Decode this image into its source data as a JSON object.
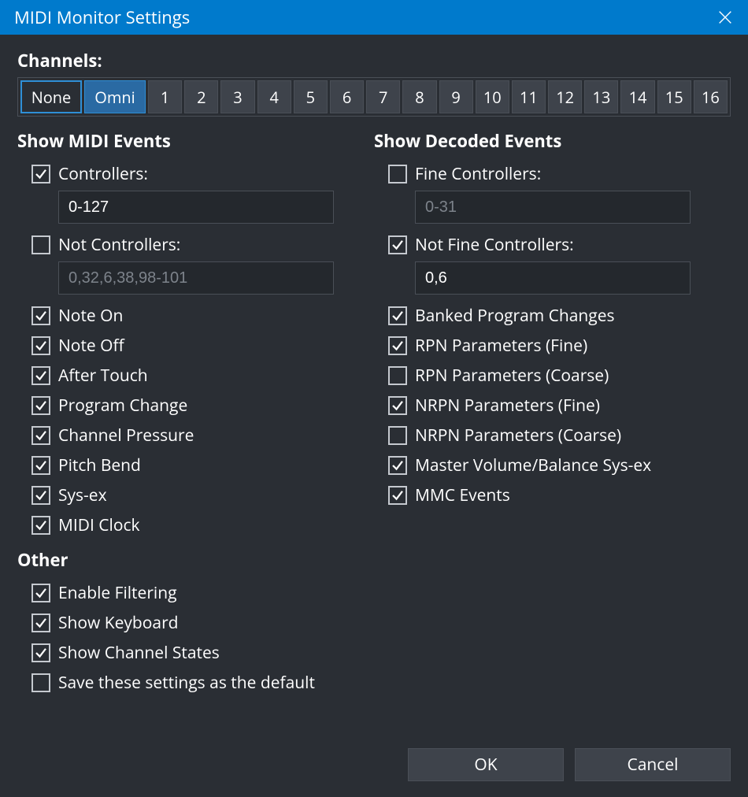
{
  "title": "MIDI Monitor Settings",
  "channels": {
    "label": "Channels:",
    "none": "None",
    "omni": "Omni",
    "nums": [
      "1",
      "2",
      "3",
      "4",
      "5",
      "6",
      "7",
      "8",
      "9",
      "10",
      "11",
      "12",
      "13",
      "14",
      "15",
      "16"
    ]
  },
  "midi_events": {
    "heading": "Show MIDI Events",
    "controllers_label": "Controllers:",
    "controllers_value": "0-127",
    "not_controllers_label": "Not Controllers:",
    "not_controllers_placeholder": "0,32,6,38,98-101",
    "note_on": "Note On",
    "note_off": "Note Off",
    "after_touch": "After Touch",
    "program_change": "Program Change",
    "channel_pressure": "Channel Pressure",
    "pitch_bend": "Pitch Bend",
    "sysex": "Sys-ex",
    "midi_clock": "MIDI Clock"
  },
  "decoded_events": {
    "heading": "Show Decoded Events",
    "fine_controllers_label": "Fine Controllers:",
    "fine_controllers_placeholder": "0-31",
    "not_fine_controllers_label": "Not Fine Controllers:",
    "not_fine_controllers_value": "0,6",
    "banked_pc": "Banked Program Changes",
    "rpn_fine": "RPN Parameters (Fine)",
    "rpn_coarse": "RPN Parameters (Coarse)",
    "nrpn_fine": "NRPN Parameters (Fine)",
    "nrpn_coarse": "NRPN Parameters (Coarse)",
    "mvb_sysex": "Master Volume/Balance Sys-ex",
    "mmc": "MMC Events"
  },
  "other": {
    "heading": "Other",
    "enable_filtering": "Enable Filtering",
    "show_keyboard": "Show Keyboard",
    "show_channel_states": "Show Channel States",
    "save_default": "Save these settings as the default"
  },
  "buttons": {
    "ok": "OK",
    "cancel": "Cancel"
  },
  "state": {
    "controllers_checked": true,
    "not_controllers_checked": false,
    "note_on": true,
    "note_off": true,
    "after_touch": true,
    "program_change": true,
    "channel_pressure": true,
    "pitch_bend": true,
    "sysex": true,
    "midi_clock": true,
    "fine_controllers_checked": false,
    "not_fine_controllers_checked": true,
    "banked_pc": true,
    "rpn_fine": true,
    "rpn_coarse": false,
    "nrpn_fine": true,
    "nrpn_coarse": false,
    "mvb_sysex": true,
    "mmc": true,
    "enable_filtering": true,
    "show_keyboard": true,
    "show_channel_states": true,
    "save_default": false
  }
}
